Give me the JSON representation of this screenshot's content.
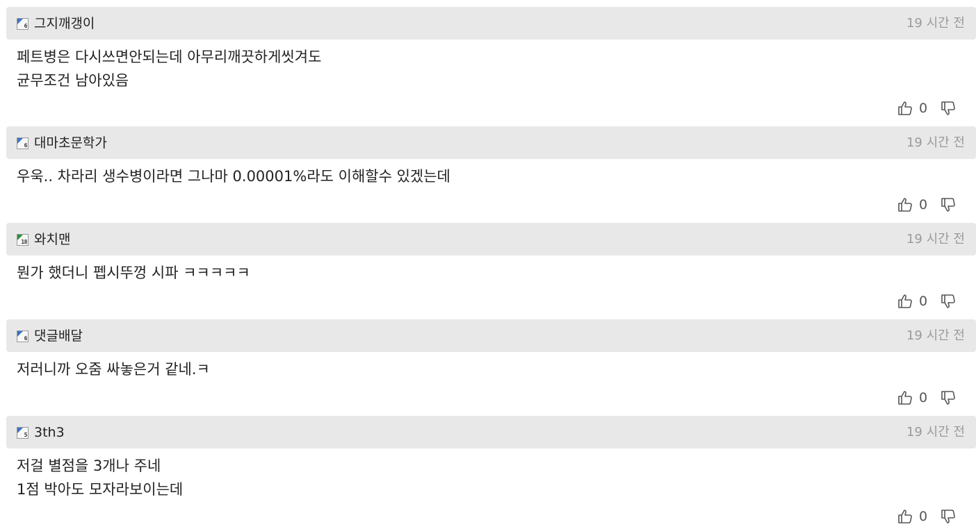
{
  "comments": [
    {
      "level": "6",
      "level_color": "#3b73c7",
      "nickname": "그지깨갱이",
      "time": "19 시간 전",
      "lines": [
        "페트병은 다시쓰면안되는데 아무리깨끗하게씻겨도",
        "균무조건 남아있음"
      ],
      "likes": "0"
    },
    {
      "level": "6",
      "level_color": "#3b73c7",
      "nickname": "대마초문학가",
      "time": "19 시간 전",
      "lines": [
        "우욱.. 차라리 생수병이라면 그나마 0.00001%라도 이해할수 있겠는데"
      ],
      "likes": "0"
    },
    {
      "level": "18",
      "level_color": "#2f8f3a",
      "nickname": "와치맨",
      "time": "19 시간 전",
      "lines": [
        "뭔가 했더니 펩시뚜껑 시파 ㅋㅋㅋㅋㅋ"
      ],
      "likes": "0"
    },
    {
      "level": "6",
      "level_color": "#3b73c7",
      "nickname": "댓글배달",
      "time": "19 시간 전",
      "lines": [
        "저러니까 오줌 싸놓은거 같네.ㅋ"
      ],
      "likes": "0"
    },
    {
      "level": "5",
      "level_color": "#3b73c7",
      "nickname": "3th3",
      "time": "19 시간 전",
      "lines": [
        "저걸 별점을 3개나 주네",
        "1점 박아도 모자라보이는데"
      ],
      "likes": "0"
    }
  ],
  "icons": {
    "like": "thumbs-up-icon",
    "dislike": "thumbs-down-icon",
    "level": "level-badge-icon"
  }
}
